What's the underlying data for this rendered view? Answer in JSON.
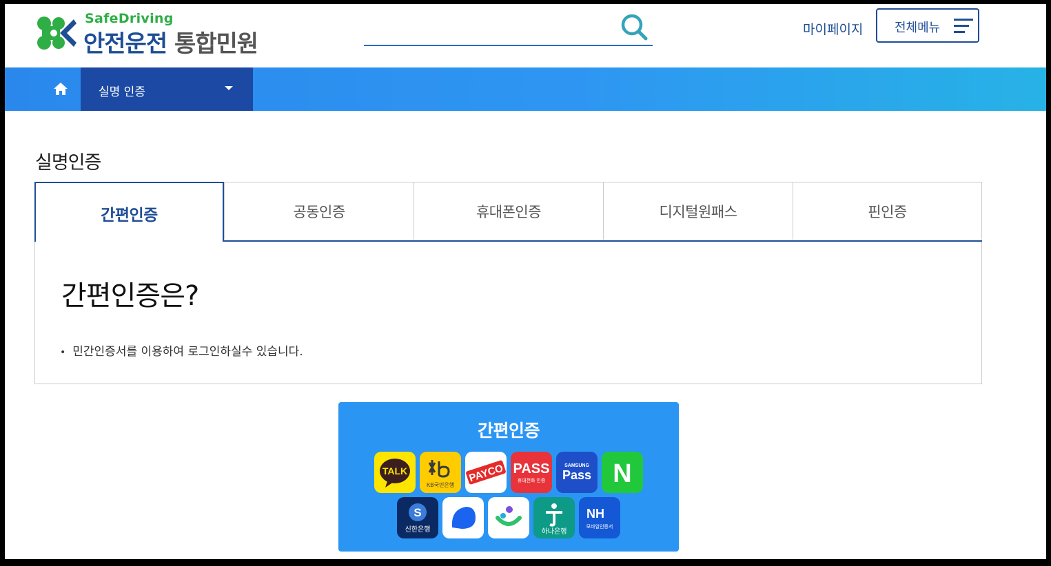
{
  "header": {
    "brand_en": "SafeDriving",
    "brand_ko_main": "안전운전",
    "brand_ko_sub": "통합민원",
    "search_value": "",
    "mypage_label": "마이페이지",
    "allmenu_label": "전체메뉴"
  },
  "nav": {
    "breadcrumb_label": "실명 인증"
  },
  "page": {
    "title": "실명인증"
  },
  "tabs": [
    {
      "label": "간편인증",
      "active": true
    },
    {
      "label": "공동인증",
      "active": false
    },
    {
      "label": "휴대폰인증",
      "active": false
    },
    {
      "label": "디지털원패스",
      "active": false
    },
    {
      "label": "핀인증",
      "active": false
    }
  ],
  "content": {
    "heading": "간편인증은?",
    "bullet": "민간인증서를 이용하여 로그인하실수 있습니다."
  },
  "easy_auth": {
    "title": "간편인증",
    "apps": [
      {
        "icon": "kakao-talk-icon",
        "text": "TALK"
      },
      {
        "icon": "kb-bank-icon",
        "text": "KB국민은행"
      },
      {
        "icon": "payco-icon",
        "text": "PAYCO"
      },
      {
        "icon": "pass-icon",
        "text": "PASS",
        "sub": "휴대전화 인증"
      },
      {
        "icon": "samsung-pass-icon",
        "text": "Pass",
        "sub": "SAMSUNG"
      },
      {
        "icon": "naver-icon",
        "text": "N"
      },
      {
        "icon": "shinhan-bank-icon",
        "text": "신한은행"
      },
      {
        "icon": "toss-icon",
        "text": ""
      },
      {
        "icon": "bank-salad-icon",
        "text": ""
      },
      {
        "icon": "hana-bank-icon",
        "text": "하나은행"
      },
      {
        "icon": "nh-icon",
        "text": "NH",
        "sub": "모바일인증서"
      }
    ]
  },
  "colors": {
    "primary_navy": "#1f4e95",
    "nav_blue": "#2e96f2",
    "breadcrumb_dark": "#1b49a3",
    "panel_blue": "#2b95f4",
    "logo_green": "#2fae46"
  }
}
